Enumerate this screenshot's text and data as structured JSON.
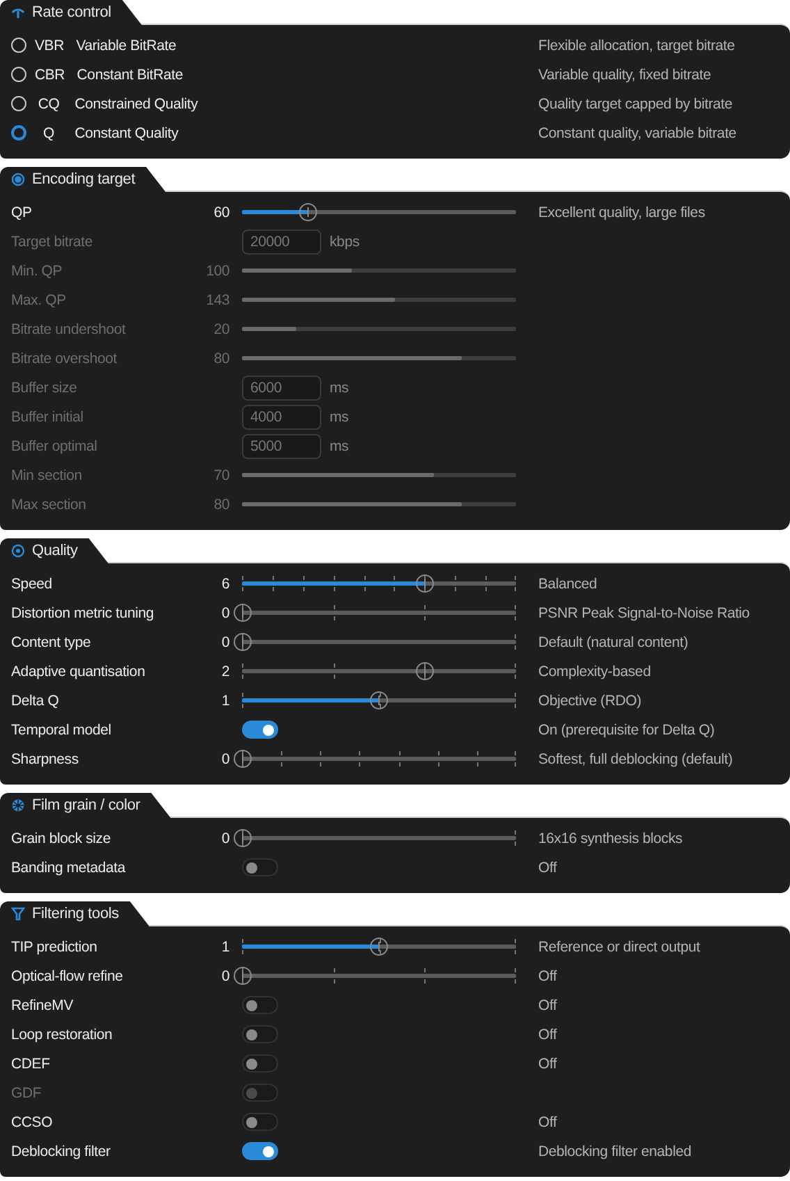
{
  "sections": [
    {
      "title": "Rate control",
      "modes": [
        {
          "code": "VBR",
          "name": "Variable BitRate",
          "description": "Flexible allocation, target bitrate",
          "selected": false
        },
        {
          "code": "CBR",
          "name": "Constant BitRate",
          "description": "Variable quality, fixed bitrate",
          "selected": false
        },
        {
          "code": "CQ",
          "name": "Constrained Quality",
          "description": "Quality target capped by bitrate",
          "selected": false
        },
        {
          "code": "Q",
          "name": "Constant Quality",
          "description": "Constant quality, variable bitrate",
          "selected": true
        }
      ]
    },
    {
      "title": "Encoding target",
      "rows": [
        {
          "kind": "slider",
          "label": "QP",
          "value": "60",
          "level": 0.24,
          "filled": true,
          "disabled": false,
          "description": "Excellent quality, large files"
        },
        {
          "kind": "field",
          "label": "Target bitrate",
          "value": "20000",
          "unit": "kbps",
          "disabled": true
        },
        {
          "kind": "slider",
          "label": "Min. QP",
          "value": "100",
          "level": 0.4,
          "filled": true,
          "disabled": true
        },
        {
          "kind": "slider",
          "label": "Max. QP",
          "value": "143",
          "level": 0.56,
          "filled": true,
          "disabled": true
        },
        {
          "kind": "slider",
          "label": "Bitrate undershoot",
          "value": "20",
          "level": 0.2,
          "filled": true,
          "disabled": true
        },
        {
          "kind": "slider",
          "label": "Bitrate overshoot",
          "value": "80",
          "level": 0.8,
          "filled": true,
          "disabled": true
        },
        {
          "kind": "field",
          "label": "Buffer size",
          "value": "6000",
          "unit": "ms",
          "disabled": true
        },
        {
          "kind": "field",
          "label": "Buffer initial",
          "value": "4000",
          "unit": "ms",
          "disabled": true
        },
        {
          "kind": "field",
          "label": "Buffer optimal",
          "value": "5000",
          "unit": "ms",
          "disabled": true
        },
        {
          "kind": "slider",
          "label": "Min section",
          "value": "70",
          "level": 0.7,
          "filled": true,
          "disabled": true
        },
        {
          "kind": "slider",
          "label": "Max section",
          "value": "80",
          "level": 0.8,
          "filled": true,
          "disabled": true
        }
      ]
    },
    {
      "title": "Quality",
      "rows": [
        {
          "kind": "slider",
          "label": "Speed",
          "value": "6",
          "level": 0.667,
          "filled": true,
          "disabled": false,
          "ticks": [
            {
              "kind": "tick"
            },
            {
              "kind": "tick"
            },
            {
              "kind": "tick"
            },
            {
              "kind": "tick"
            },
            {
              "kind": "tick"
            },
            {
              "kind": "tick"
            },
            {
              "kind": "tick"
            },
            {
              "kind": "tick"
            },
            {
              "kind": "tick"
            },
            {
              "kind": "tick"
            }
          ],
          "description": "Balanced"
        },
        {
          "kind": "slider",
          "label": "Distortion metric tuning",
          "value": "0",
          "level": 0,
          "disabled": false,
          "ticks": [
            {
              "kind": "tick"
            },
            {
              "kind": "tick"
            },
            {
              "kind": "tick"
            },
            {
              "kind": "tick"
            }
          ],
          "description": "PSNR Peak Signal-to-Noise Ratio"
        },
        {
          "kind": "slider",
          "label": "Content type",
          "value": "0",
          "level": 0,
          "disabled": false,
          "ticks": [
            {
              "kind": "tick"
            },
            {
              "kind": "tick"
            }
          ],
          "description": "Default (natural content)"
        },
        {
          "kind": "slider",
          "label": "Adaptive quantisation",
          "value": "2",
          "level": 0.667,
          "filled": false,
          "disabled": false,
          "ticks": [
            {
              "kind": "tick"
            },
            {
              "kind": "tick"
            },
            {
              "kind": "tick"
            },
            {
              "kind": "tick"
            }
          ],
          "description": "Complexity-based"
        },
        {
          "kind": "slider",
          "label": "Delta Q",
          "value": "1",
          "level": 0.5,
          "filled": true,
          "disabled": false,
          "ticks": [
            {
              "kind": "tick"
            },
            {
              "kind": "tick"
            },
            {
              "kind": "tick"
            }
          ],
          "description": "Objective (RDO)"
        },
        {
          "kind": "toggle",
          "label": "Temporal model",
          "on": true,
          "disabled": false,
          "description": "On (prerequisite for Delta Q)"
        },
        {
          "kind": "slider",
          "label": "Sharpness",
          "value": "0",
          "level": 0,
          "disabled": false,
          "ticks": [
            {
              "kind": "tick"
            },
            {
              "kind": "tick"
            },
            {
              "kind": "tick"
            },
            {
              "kind": "tick"
            },
            {
              "kind": "tick"
            },
            {
              "kind": "tick"
            },
            {
              "kind": "tick"
            },
            {
              "kind": "tick"
            }
          ],
          "description": "Softest, full deblocking (default)"
        }
      ]
    },
    {
      "title": "Film grain / color",
      "rows": [
        {
          "kind": "slider",
          "label": "Grain block size",
          "value": "0",
          "level": 0,
          "disabled": false,
          "ticks": [
            {
              "kind": "tick"
            },
            {
              "kind": "tick"
            }
          ],
          "description": "16x16 synthesis blocks"
        },
        {
          "kind": "toggle",
          "label": "Banding metadata",
          "on": false,
          "disabled": false,
          "description": "Off"
        }
      ]
    },
    {
      "title": "Filtering tools",
      "rows": [
        {
          "kind": "slider",
          "label": "TIP prediction",
          "value": "1",
          "level": 0.5,
          "filled": true,
          "disabled": false,
          "ticks": [
            {
              "kind": "tick"
            },
            {
              "kind": "tick"
            },
            {
              "kind": "tick"
            }
          ],
          "description": "Reference or direct output"
        },
        {
          "kind": "slider",
          "label": "Optical-flow refine",
          "value": "0",
          "level": 0,
          "disabled": false,
          "ticks": [
            {
              "kind": "tick"
            },
            {
              "kind": "tick"
            },
            {
              "kind": "tick"
            },
            {
              "kind": "tick"
            }
          ],
          "description": "Off"
        },
        {
          "kind": "toggle",
          "label": "RefineMV",
          "on": false,
          "disabled": false,
          "description": "Off"
        },
        {
          "kind": "toggle",
          "label": "Loop restoration",
          "on": false,
          "disabled": false,
          "description": "Off"
        },
        {
          "kind": "toggle",
          "label": "CDEF",
          "on": false,
          "disabled": false,
          "description": "Off"
        },
        {
          "kind": "toggle",
          "label": "GDF",
          "on": false,
          "disabled": true
        },
        {
          "kind": "toggle",
          "label": "CCSO",
          "on": false,
          "disabled": false,
          "description": "Off"
        },
        {
          "kind": "toggle",
          "label": "Deblocking filter",
          "on": true,
          "disabled": false,
          "description": "Deblocking filter enabled"
        }
      ]
    }
  ]
}
